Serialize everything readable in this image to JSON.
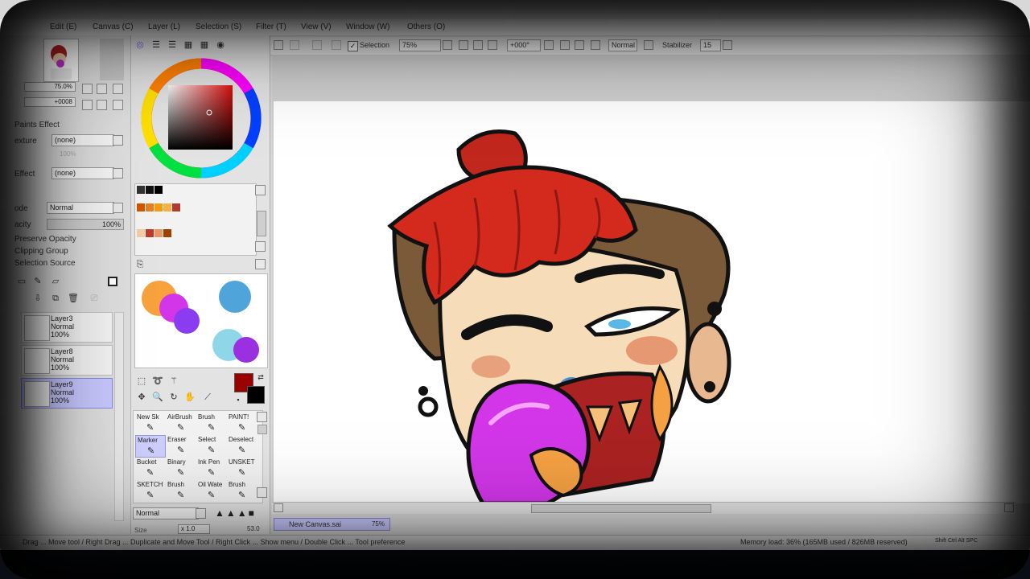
{
  "menu": [
    "Edit (E)",
    "Canvas (C)",
    "Layer (L)",
    "Selection (S)",
    "Filter (T)",
    "View (V)",
    "Window (W)",
    "Others (O)"
  ],
  "toolbar": {
    "selection_label": "Selection",
    "selection_checked": true,
    "zoom_value": "75%",
    "rotation_value": "+000°",
    "blend_mode": "Normal",
    "stabilizer_label": "Stabilizer",
    "stabilizer_value": "15"
  },
  "navigator": {
    "zoom": "75.0%",
    "angle": "+0008"
  },
  "effects": {
    "section_title": "Paints Effect",
    "texture_label": "exture",
    "texture_value": "(none)",
    "texture_amount": "100%",
    "effect_label": "Effect",
    "effect_value": "(none)",
    "mode_label": "ode",
    "mode_value": "Normal",
    "opacity_label": "acity",
    "opacity_value": "100%",
    "preserve_opacity": "Preserve Opacity",
    "clipping_group": "Clipping Group",
    "selection_source": "Selection Source"
  },
  "layers": [
    {
      "name": "Layer3",
      "mode": "Normal",
      "opacity": "100%",
      "selected": false
    },
    {
      "name": "Layer8",
      "mode": "Normal",
      "opacity": "100%",
      "selected": false
    },
    {
      "name": "Layer9",
      "mode": "Normal",
      "opacity": "100%",
      "selected": true
    }
  ],
  "colors": {
    "primary": "#9b0000",
    "secondary": "#000000",
    "accent_selected": "#c8c8ff",
    "swatches_row1": [
      "#333333",
      "#111111",
      "#000000"
    ],
    "swatches_row2": [
      "#d35400",
      "#e67e22",
      "#f39c12",
      "#f5b041",
      "#b03a2e"
    ],
    "swatches_row3": [
      "#f5cba7",
      "#c0392b",
      "#e59866",
      "#a04000"
    ],
    "scratch": [
      "#f7a23c",
      "#d236e8",
      "#8a3cf0",
      "#4fa5d9",
      "#8fd7e8",
      "#9b30e0"
    ]
  },
  "tools": [
    [
      "New Sk",
      "AirBrush",
      "Brush",
      "PAINT!"
    ],
    [
      "Marker",
      "Eraser",
      "Select",
      "Deselect"
    ],
    [
      "Bucket",
      "Binary",
      "Ink Pen",
      "UNSKET"
    ],
    [
      "SKETCH",
      "Brush",
      "Oil Wate",
      "Brush"
    ]
  ],
  "brush": {
    "mode": "Normal",
    "size_label": "Size",
    "size_multiplier": "x 1.0",
    "size_value": "53.0"
  },
  "document": {
    "tab_name": "New Canvas.sai",
    "tab_zoom": "75%"
  },
  "status": {
    "hint": "Drag ... Move tool / Right Drag ... Duplicate and Move Tool / Right Click ... Show menu / Double Click ... Tool preference",
    "memory": "Memory load: 36% (165MB used / 826MB reserved)",
    "keys": "Shift Ctrl Alt SPC"
  }
}
